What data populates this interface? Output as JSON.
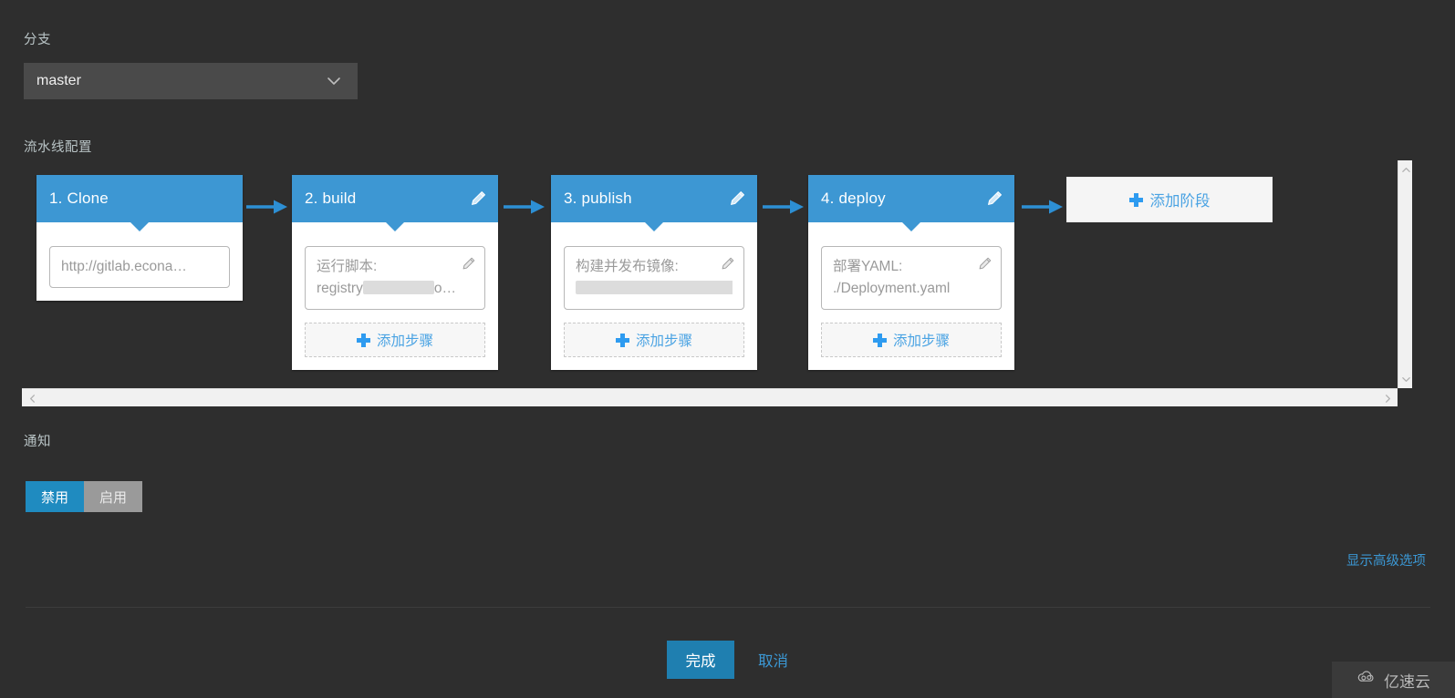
{
  "branch": {
    "label": "分支",
    "value": "master",
    "chevron_icon": "chevron-down-icon"
  },
  "pipeline": {
    "label": "流水线配置",
    "add_stage_label": "添加阶段",
    "add_step_label": "添加步骤",
    "stages": [
      {
        "title": "1. Clone",
        "has_edit": false,
        "has_add_step": false,
        "steps": [
          {
            "line1": "http://gitlab.econa…",
            "line2": "",
            "has_edit": false,
            "redacted": false
          }
        ]
      },
      {
        "title": "2. build",
        "has_edit": true,
        "has_add_step": true,
        "steps": [
          {
            "line1": "运行脚本:",
            "line2_prefix": "registry",
            "line2_suffix": "o…",
            "has_edit": true,
            "redacted": true,
            "redact_width": 78
          }
        ]
      },
      {
        "title": "3. publish",
        "has_edit": true,
        "has_add_step": true,
        "steps": [
          {
            "line1": "构建并发布镜像:",
            "line2_prefix": "",
            "line2_suffix": "",
            "has_edit": true,
            "redacted": true,
            "redact_width": 186
          }
        ]
      },
      {
        "title": "4. deploy",
        "has_edit": true,
        "has_add_step": true,
        "steps": [
          {
            "line1": "部署YAML:",
            "line2": "./Deployment.yaml",
            "has_edit": true,
            "redacted": false
          }
        ]
      }
    ],
    "scrollbar": {
      "up_icon": "chevron-up-icon",
      "down_icon": "chevron-down-icon",
      "left_icon": "chevron-left-icon",
      "right_icon": "chevron-right-icon"
    }
  },
  "notification": {
    "label": "通知",
    "options": [
      {
        "label": "禁用",
        "active": true
      },
      {
        "label": "启用",
        "active": false
      }
    ]
  },
  "advanced_link": "显示高级选项",
  "footer": {
    "confirm_label": "完成",
    "cancel_label": "取消"
  },
  "watermark": {
    "text": "亿速云",
    "icon": "cloud-icon"
  },
  "colors": {
    "background": "#2e2e2e",
    "accent_blue": "#3d97d3",
    "link_blue": "#3b97d3",
    "button_blue": "#1f7fb0",
    "toggle_active": "#1f8bc0",
    "toggle_inactive": "#9a9a9a",
    "card_white": "#ffffff"
  }
}
